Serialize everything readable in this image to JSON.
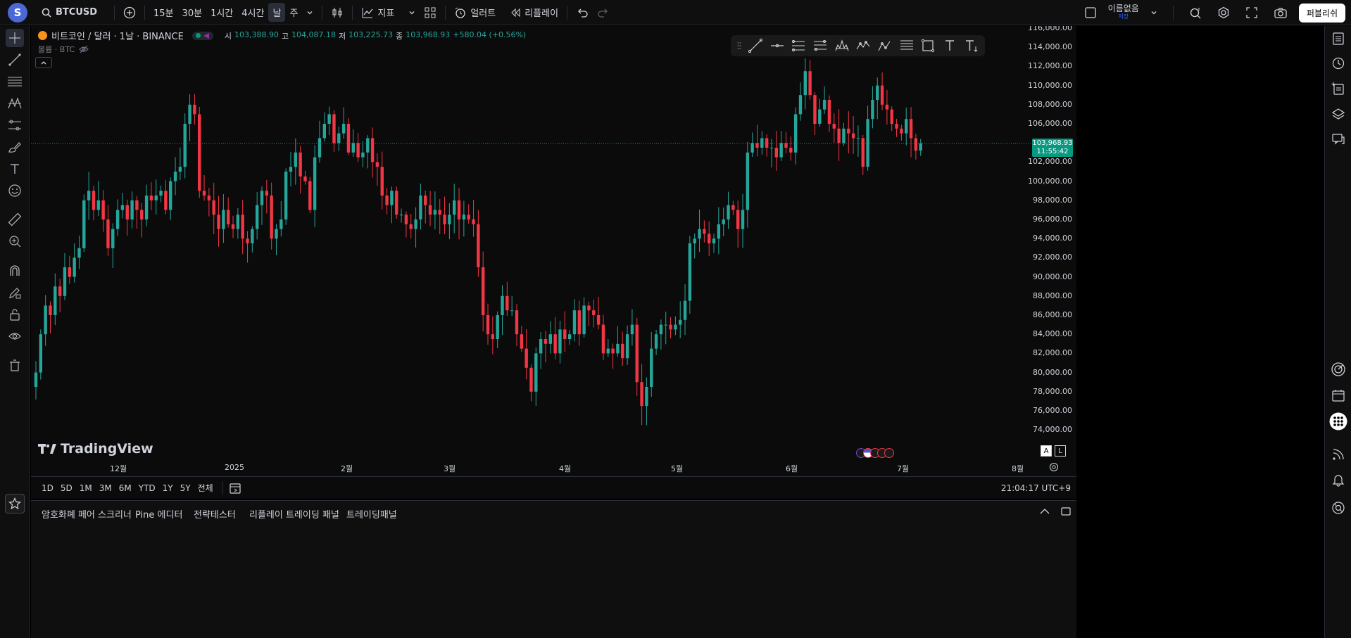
{
  "topbar": {
    "logo_letter": "S",
    "symbol": "BTCUSD",
    "intervals": [
      "15분",
      "30분",
      "1시간",
      "4시간",
      "날",
      "주"
    ],
    "active_interval": "날",
    "indicators_label": "지표",
    "alert_label": "얼러트",
    "replay_label": "리플레이",
    "layout_name": "이름없음",
    "layout_status": "저장",
    "publish_label": "퍼블리쉬"
  },
  "legend": {
    "title": "비트코인 / 달러 · 1날 · BINANCE",
    "open_label": "시",
    "open": "103,388.90",
    "high_label": "고",
    "high": "104,087.18",
    "low_label": "저",
    "low": "103,225.73",
    "close_label": "종",
    "close": "103,968.93",
    "change": "+580.04 (+0.56%)",
    "volume_label": "볼륨 · BTC"
  },
  "price_axis": {
    "labels": [
      "116,000.00",
      "114,000.00",
      "112,000.00",
      "110,000.00",
      "108,000.00",
      "106,000.00",
      "102,000.00",
      "100,000.00",
      "98,000.00",
      "96,000.00",
      "94,000.00",
      "92,000.00",
      "90,000.00",
      "88,000.00",
      "86,000.00",
      "84,000.00",
      "82,000.00",
      "80,000.00",
      "78,000.00",
      "76,000.00",
      "74,000.00"
    ],
    "current_price": "103,968.93",
    "countdown": "11:55:42"
  },
  "time_axis": {
    "labels": [
      "12월",
      "2025",
      "2월",
      "3월",
      "4월",
      "5월",
      "6월",
      "7월",
      "8월"
    ]
  },
  "branding": {
    "name": "TradingView"
  },
  "scale_buttons": {
    "auto": "A",
    "log": "L"
  },
  "range_buttons": [
    "1D",
    "5D",
    "1M",
    "3M",
    "6M",
    "YTD",
    "1Y",
    "5Y",
    "전체"
  ],
  "clock": "21:04:17 UTC+9",
  "bottom_tabs": [
    "암호화폐 페어 스크리너",
    "Pine 에디터",
    "전략테스터",
    "리플레이 트레이딩 패널",
    "트레이딩패널"
  ],
  "colors": {
    "up": "#26a69a",
    "down": "#f23645",
    "current": "#089981"
  },
  "chart_data": {
    "type": "candlestick",
    "title": "비트코인 / 달러 · 1날 · BINANCE",
    "ylim": [
      73000,
      116500
    ],
    "closes": [
      80000,
      84000,
      87000,
      86000,
      89000,
      88000,
      91000,
      90000,
      92000,
      93000,
      98000,
      99000,
      97000,
      98000,
      96000,
      93000,
      95000,
      97000,
      97500,
      96000,
      98000,
      97000,
      96000,
      98500,
      98000,
      98500,
      99000,
      97000,
      100000,
      101000,
      101500,
      106000,
      108000,
      107000,
      99000,
      98500,
      98000,
      96500,
      95000,
      97000,
      95500,
      95000,
      96500,
      94000,
      93500,
      95000,
      97500,
      99000,
      98500,
      94000,
      95000,
      96000,
      101000,
      101500,
      103000,
      100500,
      100000,
      97000,
      102500,
      104500,
      106000,
      107000,
      104000,
      105000,
      106000,
      103000,
      104000,
      102500,
      103000,
      104500,
      102000,
      101500,
      98500,
      97500,
      99000,
      96500,
      96500,
      95500,
      95000,
      96000,
      98500,
      97500,
      96500,
      97000,
      96500,
      95500,
      96500,
      98000,
      96000,
      96500,
      96000,
      95500,
      91000,
      86000,
      84000,
      83500,
      86000,
      88000,
      86500,
      86500,
      84000,
      82500,
      80500,
      78000,
      82000,
      83500,
      83000,
      84000,
      82000,
      84500,
      83500,
      84000,
      86500,
      84000,
      87000,
      86500,
      86000,
      85000,
      82000,
      82500,
      82000,
      83000,
      81500,
      84000,
      85000,
      79000,
      76500,
      78500,
      82500,
      84000,
      85000,
      85000,
      84500,
      85000,
      85500,
      87500,
      93500,
      94000,
      95000,
      94500,
      93500,
      94000,
      95500,
      96000,
      97500,
      97000,
      95000,
      97000,
      103000,
      104000,
      103500,
      104500,
      103500,
      103500,
      102500,
      104000,
      103500,
      103000,
      107000,
      109000,
      111500,
      109000,
      106000,
      107500,
      108500,
      106000,
      105500,
      104000,
      105500,
      105000,
      104500,
      104500,
      101500,
      106500,
      108500,
      110000,
      108000,
      107500,
      106000,
      105500,
      105000,
      106500,
      104500,
      103200,
      103969
    ]
  }
}
